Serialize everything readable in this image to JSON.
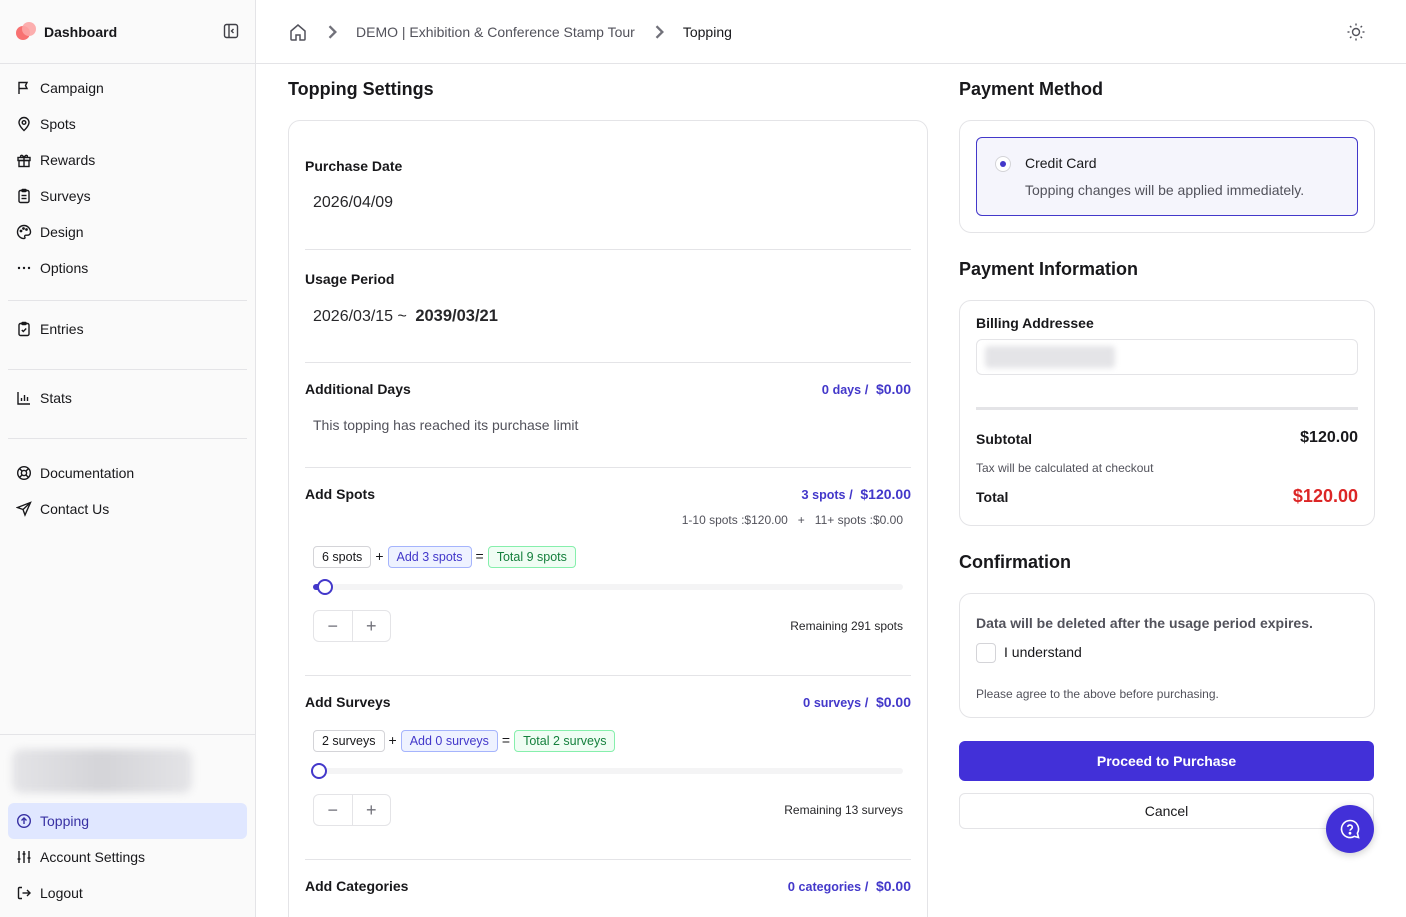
{
  "sidebar": {
    "title": "Dashboard",
    "items": [
      {
        "label": "Campaign",
        "icon": "flag-icon"
      },
      {
        "label": "Spots",
        "icon": "map-pin-icon"
      },
      {
        "label": "Rewards",
        "icon": "gift-icon"
      },
      {
        "label": "Surveys",
        "icon": "clipboard-icon"
      },
      {
        "label": "Design",
        "icon": "palette-icon"
      },
      {
        "label": "Options",
        "icon": "ellipsis-icon"
      }
    ],
    "entries": {
      "label": "Entries",
      "icon": "clipboard-check-icon"
    },
    "stats": {
      "label": "Stats",
      "icon": "bar-chart-icon"
    },
    "help": [
      {
        "label": "Documentation",
        "icon": "lifebuoy-icon"
      },
      {
        "label": "Contact Us",
        "icon": "send-icon"
      }
    ],
    "bottom": {
      "topping": "Topping",
      "account_settings": "Account Settings",
      "logout": "Logout"
    }
  },
  "header": {
    "breadcrumb": {
      "home_icon": "home-icon",
      "campaign": "DEMO | Exhibition & Conference Stamp Tour",
      "current": "Topping"
    },
    "theme_icon": "sun-icon"
  },
  "topping": {
    "title": "Topping Settings",
    "purchase_date": {
      "label": "Purchase Date",
      "value": "2026/04/09"
    },
    "usage_period": {
      "label": "Usage Period",
      "start": "2026/03/15 ~",
      "end": "2039/03/21"
    },
    "additional_days": {
      "label": "Additional Days",
      "qty": "0",
      "unit": "days",
      "price": "$0.00",
      "note": "This topping has reached its purchase limit"
    },
    "add_spots": {
      "label": "Add Spots",
      "qty": "3",
      "unit": "spots",
      "price": "$120.00",
      "tiers": "1-10 spots :$120.00   +   11+ spots :$0.00",
      "current": "6 spots",
      "add": "Add 3 spots",
      "total": "Total 9 spots",
      "slider_fraction": 0.01,
      "remaining": "Remaining 291 spots"
    },
    "add_surveys": {
      "label": "Add Surveys",
      "qty": "0",
      "unit": "surveys",
      "price": "$0.00",
      "current": "2 surveys",
      "add": "Add 0 surveys",
      "total": "Total 2 surveys",
      "slider_fraction": 0,
      "remaining": "Remaining 13 surveys"
    },
    "add_categories": {
      "label": "Add Categories",
      "qty": "0",
      "unit": "categories",
      "price": "$0.00"
    },
    "plus": "+",
    "equals": "=",
    "slash": "/",
    "minus_glyph": "−",
    "plus_glyph": "+"
  },
  "payment_method": {
    "title": "Payment Method",
    "option_label": "Credit Card",
    "option_desc": "Topping changes will be applied immediately."
  },
  "payment_info": {
    "title": "Payment Information",
    "billing_label": "Billing Addressee",
    "subtotal_label": "Subtotal",
    "subtotal": "$120.00",
    "tax_note": "Tax will be calculated at checkout",
    "total_label": "Total",
    "total": "$120.00"
  },
  "confirmation": {
    "title": "Confirmation",
    "warning": "Data will be deleted after the usage period expires.",
    "checkbox_label": "I understand",
    "note": "Please agree to the above before purchasing."
  },
  "actions": {
    "purchase": "Proceed to Purchase",
    "cancel": "Cancel",
    "help_icon": "help-chat-icon"
  },
  "colors": {
    "accent": "#4230d8",
    "total_red": "#dc2626",
    "active_bg": "#e0e7ff"
  }
}
